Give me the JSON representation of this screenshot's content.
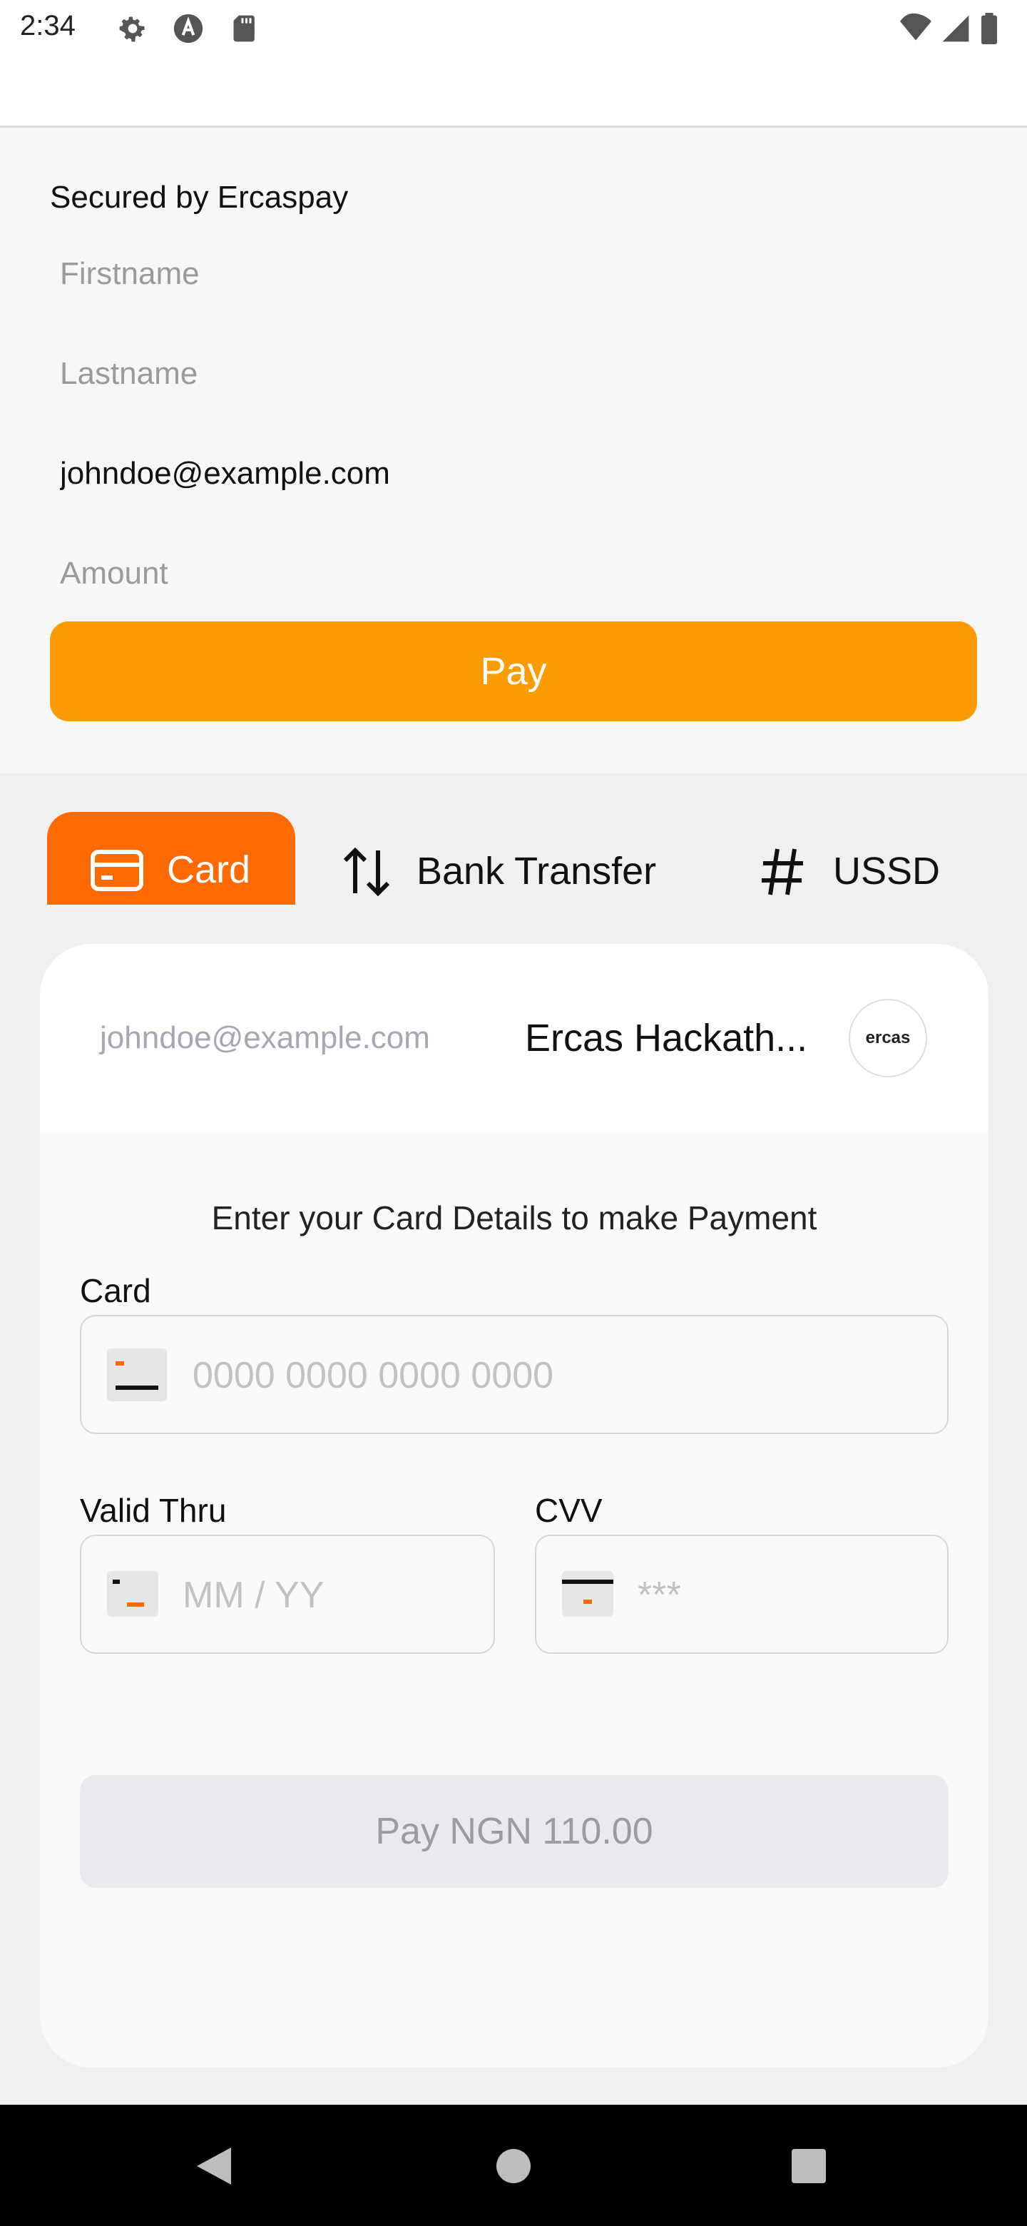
{
  "status_bar": {
    "time": "2:34",
    "icons": [
      "gear-icon",
      "a-circle-icon",
      "sd-card-icon",
      "wifi-icon",
      "signal-icon",
      "battery-icon"
    ]
  },
  "form": {
    "secured_text": "Secured by Ercaspay",
    "firstname_placeholder": "Firstname",
    "lastname_placeholder": "Lastname",
    "email_value": "johndoe@example.com",
    "amount_placeholder": "Amount",
    "pay_label": "Pay"
  },
  "tabs": [
    {
      "label": "Card",
      "icon": "credit-card-icon",
      "active": true
    },
    {
      "label": "Bank Transfer",
      "icon": "arrows-up-down-icon",
      "active": false
    },
    {
      "label": "USSD",
      "icon": "hash-icon",
      "active": false
    }
  ],
  "checkout": {
    "email": "johndoe@example.com",
    "merchant_name": "Ercas Hackath...",
    "logo_text": "ercas",
    "instruction": "Enter your Card Details to make Payment",
    "card_label": "Card",
    "card_placeholder": "0000 0000 0000 0000",
    "valid_label": "Valid Thru",
    "valid_placeholder": "MM / YY",
    "cvv_label": "CVV",
    "cvv_placeholder": "***",
    "pay_label": "Pay NGN 110.00"
  },
  "colors": {
    "pay_orange": "#fd9b04",
    "tab_orange": "#ff6a00",
    "disabled_button": "#e9eaed"
  },
  "nav": {
    "icons": [
      "back-icon",
      "home-icon",
      "recents-icon"
    ]
  }
}
